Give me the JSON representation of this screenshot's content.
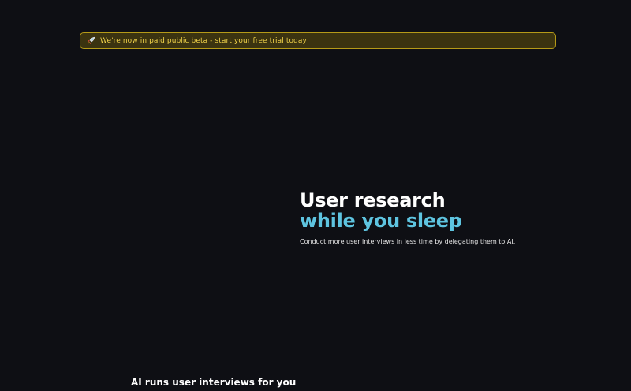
{
  "banner": {
    "icon": "rocket-icon",
    "text": "We're now in paid public beta - start your free trial today",
    "border_color": "#b59a18",
    "background_color": "#3b3310",
    "text_color": "#f0d24a"
  },
  "hero": {
    "title_line1": "User research",
    "title_line2": "while you sleep",
    "subtitle": "Conduct more user interviews in less time by delegating them to AI.",
    "accent_color": "#5ec4e0"
  },
  "section": {
    "heading": "AI runs user interviews for you"
  },
  "theme": {
    "background": "#0e0f14"
  }
}
